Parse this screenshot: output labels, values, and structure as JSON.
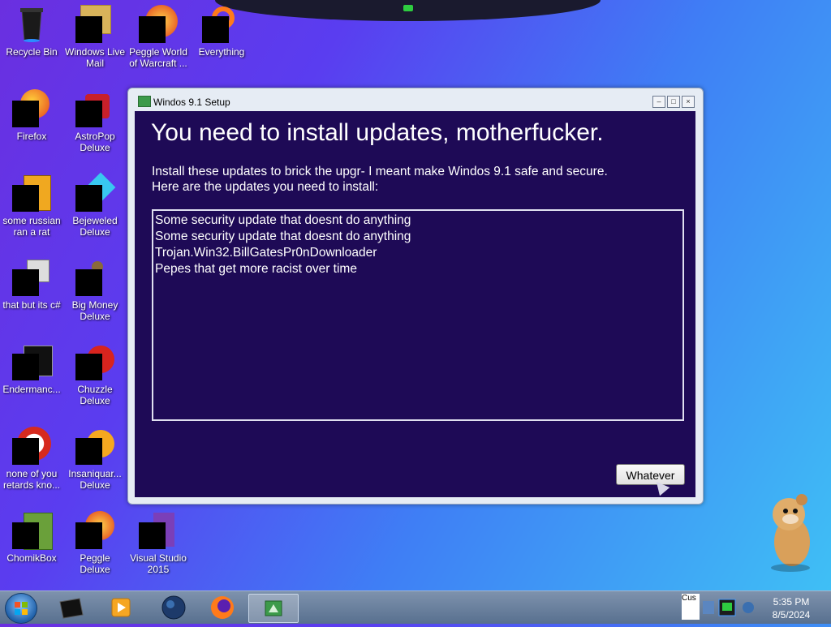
{
  "desktop": {
    "icons": [
      {
        "label": "Recycle Bin"
      },
      {
        "label": "Windows Live Mail"
      },
      {
        "label": "Peggle World of Warcraft ..."
      },
      {
        "label": "Everything"
      },
      {
        "label": "Firefox"
      },
      {
        "label": "AstroPop Deluxe"
      },
      {
        "label": "some russian ran a rat"
      },
      {
        "label": "Bejeweled Deluxe"
      },
      {
        "label": "that but its c#"
      },
      {
        "label": "Big Money Deluxe"
      },
      {
        "label": "Endermanc..."
      },
      {
        "label": "Chuzzle Deluxe"
      },
      {
        "label": "none of you retards kno..."
      },
      {
        "label": "Insaniquar... Deluxe"
      },
      {
        "label": "ChomikBox"
      },
      {
        "label": "Peggle Deluxe"
      },
      {
        "label": "Visual Studio 2015"
      }
    ]
  },
  "dialog": {
    "title": "Windos 9.1 Setup",
    "heading": "You need to install updates, motherfucker.",
    "description_line1": "Install these updates to brick the upgr- I meant make Windos 9.1 safe and secure.",
    "description_line2": "Here are the updates you need to install:",
    "updates": [
      "Some security update that doesnt do anything",
      "Some security update that doesnt do anything",
      "Trojan.Win32.BillGatesPr0nDownloader",
      "Pepes that get more racist over time"
    ],
    "button_label": "Whatever"
  },
  "taskbar": {
    "tray_text": "Cus",
    "time": "5:35 PM",
    "date": "8/5/2024"
  },
  "colors": {
    "dialog_background": "#1e0a56",
    "taskbar": "#6a82a0"
  }
}
